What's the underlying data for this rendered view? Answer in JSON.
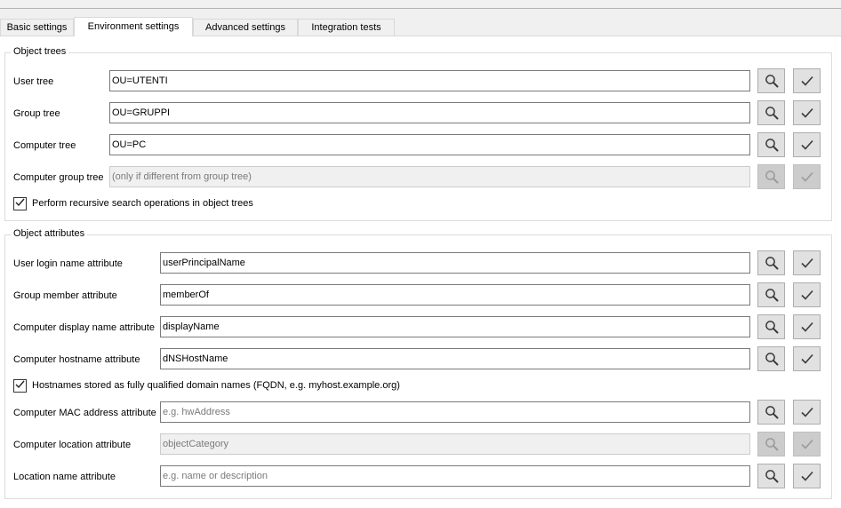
{
  "tabs": [
    {
      "label": "Basic settings"
    },
    {
      "label": "Environment settings"
    },
    {
      "label": "Advanced settings"
    },
    {
      "label": "Integration tests"
    }
  ],
  "object_trees": {
    "title": "Object trees",
    "rows": [
      {
        "label": "User tree",
        "value": "OU=UTENTI",
        "placeholder": "",
        "enabled": true
      },
      {
        "label": "Group tree",
        "value": "OU=GRUPPI",
        "placeholder": "",
        "enabled": true
      },
      {
        "label": "Computer tree",
        "value": "OU=PC",
        "placeholder": "",
        "enabled": true
      },
      {
        "label": "Computer group tree",
        "value": "",
        "placeholder": "(only if different from group tree)",
        "enabled": false
      }
    ],
    "recursive_checkbox": {
      "label": "Perform recursive search operations in object trees",
      "checked": true
    }
  },
  "object_attributes": {
    "title": "Object attributes",
    "rows": [
      {
        "label": "User login name attribute",
        "value": "userPrincipalName",
        "placeholder": "",
        "enabled": true
      },
      {
        "label": "Group member attribute",
        "value": "memberOf",
        "placeholder": "",
        "enabled": true
      },
      {
        "label": "Computer display name attribute",
        "value": "displayName",
        "placeholder": "",
        "enabled": true
      },
      {
        "label": "Computer hostname attribute",
        "value": "dNSHostName",
        "placeholder": "",
        "enabled": true
      }
    ],
    "fqdn_checkbox": {
      "label": "Hostnames stored as fully qualified domain names (FQDN, e.g. myhost.example.org)",
      "checked": true
    },
    "rows2": [
      {
        "label": "Computer MAC address attribute",
        "value": "",
        "placeholder": "e.g. hwAddress",
        "enabled": true
      },
      {
        "label": "Computer location attribute",
        "value": "",
        "placeholder": "objectCategory",
        "enabled": false
      },
      {
        "label": "Location name attribute",
        "value": "",
        "placeholder": "e.g. name or description",
        "enabled": true
      }
    ]
  },
  "icons": {
    "browse": "magnifier-icon",
    "test": "checkmark-icon"
  }
}
